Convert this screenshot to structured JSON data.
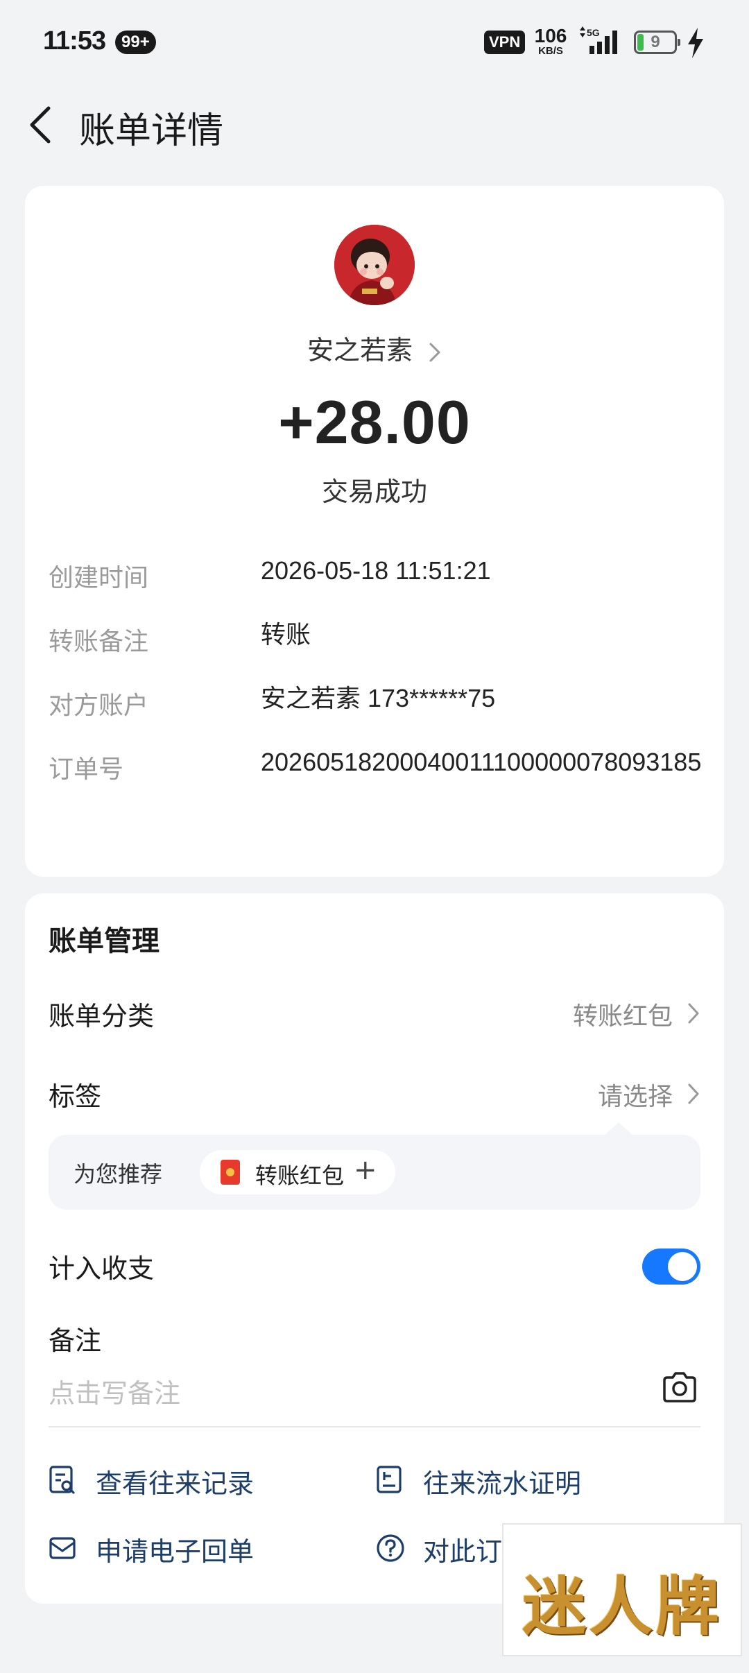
{
  "status_bar": {
    "time": "11:53",
    "notif_badge": "99+",
    "vpn": "VPN",
    "net_speed": "106",
    "net_unit": "KB/S",
    "network": "5G",
    "battery": "9"
  },
  "header": {
    "title": "账单详情"
  },
  "bill": {
    "counterparty_name": "安之若素",
    "amount": "+28.00",
    "status": "交易成功",
    "details": [
      {
        "label": "创建时间",
        "value": "2026-05-18 11:51:21"
      },
      {
        "label": "转账备注",
        "value": "转账"
      },
      {
        "label": "对方账户",
        "value": "安之若素 173******75"
      },
      {
        "label": "订单号",
        "value": "20260518200040011100000078093185"
      }
    ]
  },
  "manage": {
    "title": "账单管理",
    "category_label": "账单分类",
    "category_value": "转账红包",
    "tag_label": "标签",
    "tag_value": "请选择",
    "recommend_label": "为您推荐",
    "recommend_chip": "转账红包",
    "recommend_add": "+",
    "include_label": "计入收支",
    "include_enabled": true,
    "note_label": "备注",
    "note_placeholder": "点击写备注"
  },
  "links": [
    {
      "label": "查看往来记录",
      "icon": "record-search-icon"
    },
    {
      "label": "往来流水证明",
      "icon": "statement-icon"
    },
    {
      "label": "申请电子回单",
      "icon": "mail-icon"
    },
    {
      "label": "对此订",
      "icon": "help-icon"
    }
  ],
  "watermark": "迷人牌",
  "colors": {
    "accent": "#1677ff",
    "link": "#1d3d6b",
    "label_gray": "#9a9a9a"
  }
}
